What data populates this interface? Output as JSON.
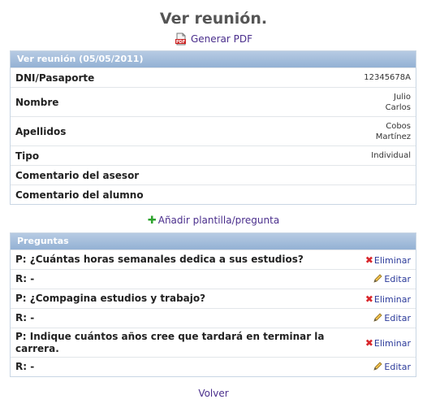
{
  "page": {
    "title": "Ver reunión.",
    "pdf_link": "Generar PDF"
  },
  "meeting": {
    "header": "Ver reunión (05/05/2011)",
    "fields": [
      {
        "label": "DNI/Pasaporte",
        "value": "12345678A"
      },
      {
        "label": "Nombre",
        "value_lines": [
          "Julio",
          "Carlos"
        ]
      },
      {
        "label": "Apellidos",
        "value_lines": [
          "Cobos",
          "Martínez"
        ]
      },
      {
        "label": "Tipo",
        "value": "Individual"
      },
      {
        "label": "Comentario del asesor",
        "value": ""
      },
      {
        "label": "Comentario del alumno",
        "value": ""
      }
    ]
  },
  "add_link": "Añadir plantilla/pregunta",
  "questions": {
    "header": "Preguntas",
    "items": [
      {
        "question": "P: ¿Cuántas horas semanales dedica a sus estudios?",
        "answer": "R: -"
      },
      {
        "question": "P: ¿Compagina estudios y trabajo?",
        "answer": "R: -"
      },
      {
        "question_lines": [
          "P: Indique cuántos años cree que tardará en terminar la",
          "carrera."
        ],
        "answer": "R: -"
      }
    ],
    "delete_label": "Eliminar",
    "edit_label": "Editar"
  },
  "back_link": "Volver",
  "colors": {
    "header_gradient_top": "#b7cbe3",
    "header_gradient_bottom": "#93b1d4",
    "link": "#4a2e8c",
    "delete": "#d8262b",
    "add": "#2da32d"
  },
  "icons": {
    "pdf": "pdf-file-icon",
    "add": "plus-icon",
    "delete": "red-x-icon",
    "edit": "pencil-icon"
  }
}
